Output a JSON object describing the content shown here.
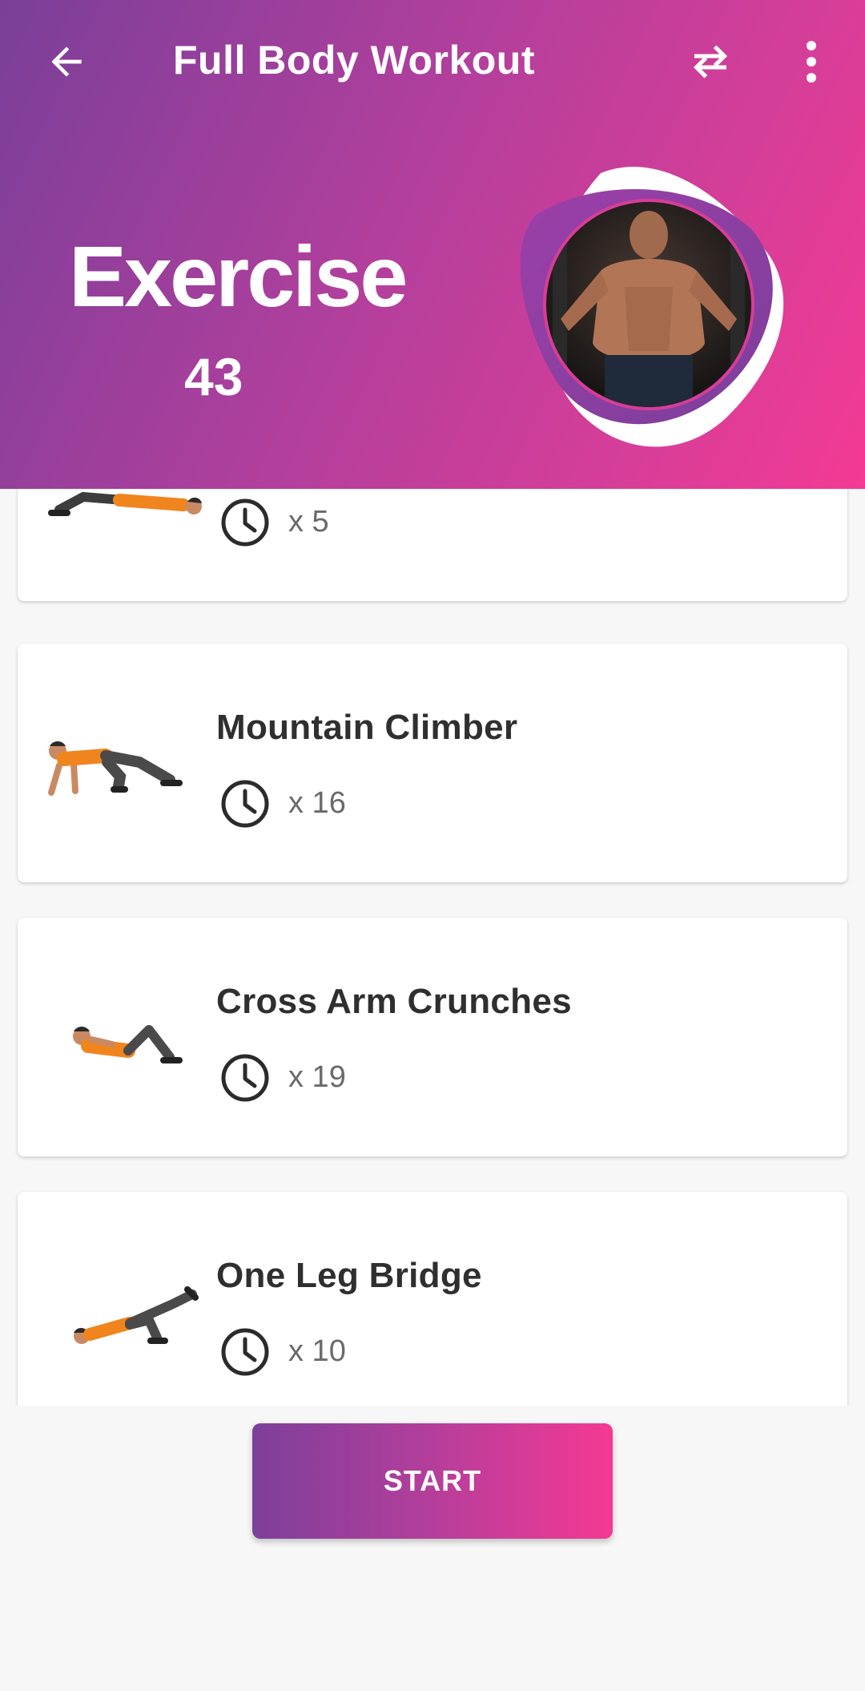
{
  "toolbar": {
    "title": "Full Body Workout",
    "back_icon": "arrow-left-icon",
    "swap_icon": "swap-arrows-icon",
    "more_icon": "more-vert-icon"
  },
  "hero": {
    "title": "Exercise",
    "count": "43",
    "image": "muscular-man-photo"
  },
  "exercises": [
    {
      "name": "",
      "reps": "x 5",
      "figure": "lying-exercise-figure"
    },
    {
      "name": "Mountain Climber",
      "reps": "x 16",
      "figure": "mountain-climber-figure"
    },
    {
      "name": "Cross Arm Crunches",
      "reps": "x 19",
      "figure": "crunch-figure"
    },
    {
      "name": "One Leg Bridge",
      "reps": "x 10",
      "figure": "bridge-figure"
    }
  ],
  "start_button": {
    "label": "START"
  },
  "colors": {
    "gradient_start": "#7a3f9a",
    "gradient_end": "#f43a94",
    "card_bg": "#ffffff",
    "page_bg": "#f7f7f7"
  }
}
